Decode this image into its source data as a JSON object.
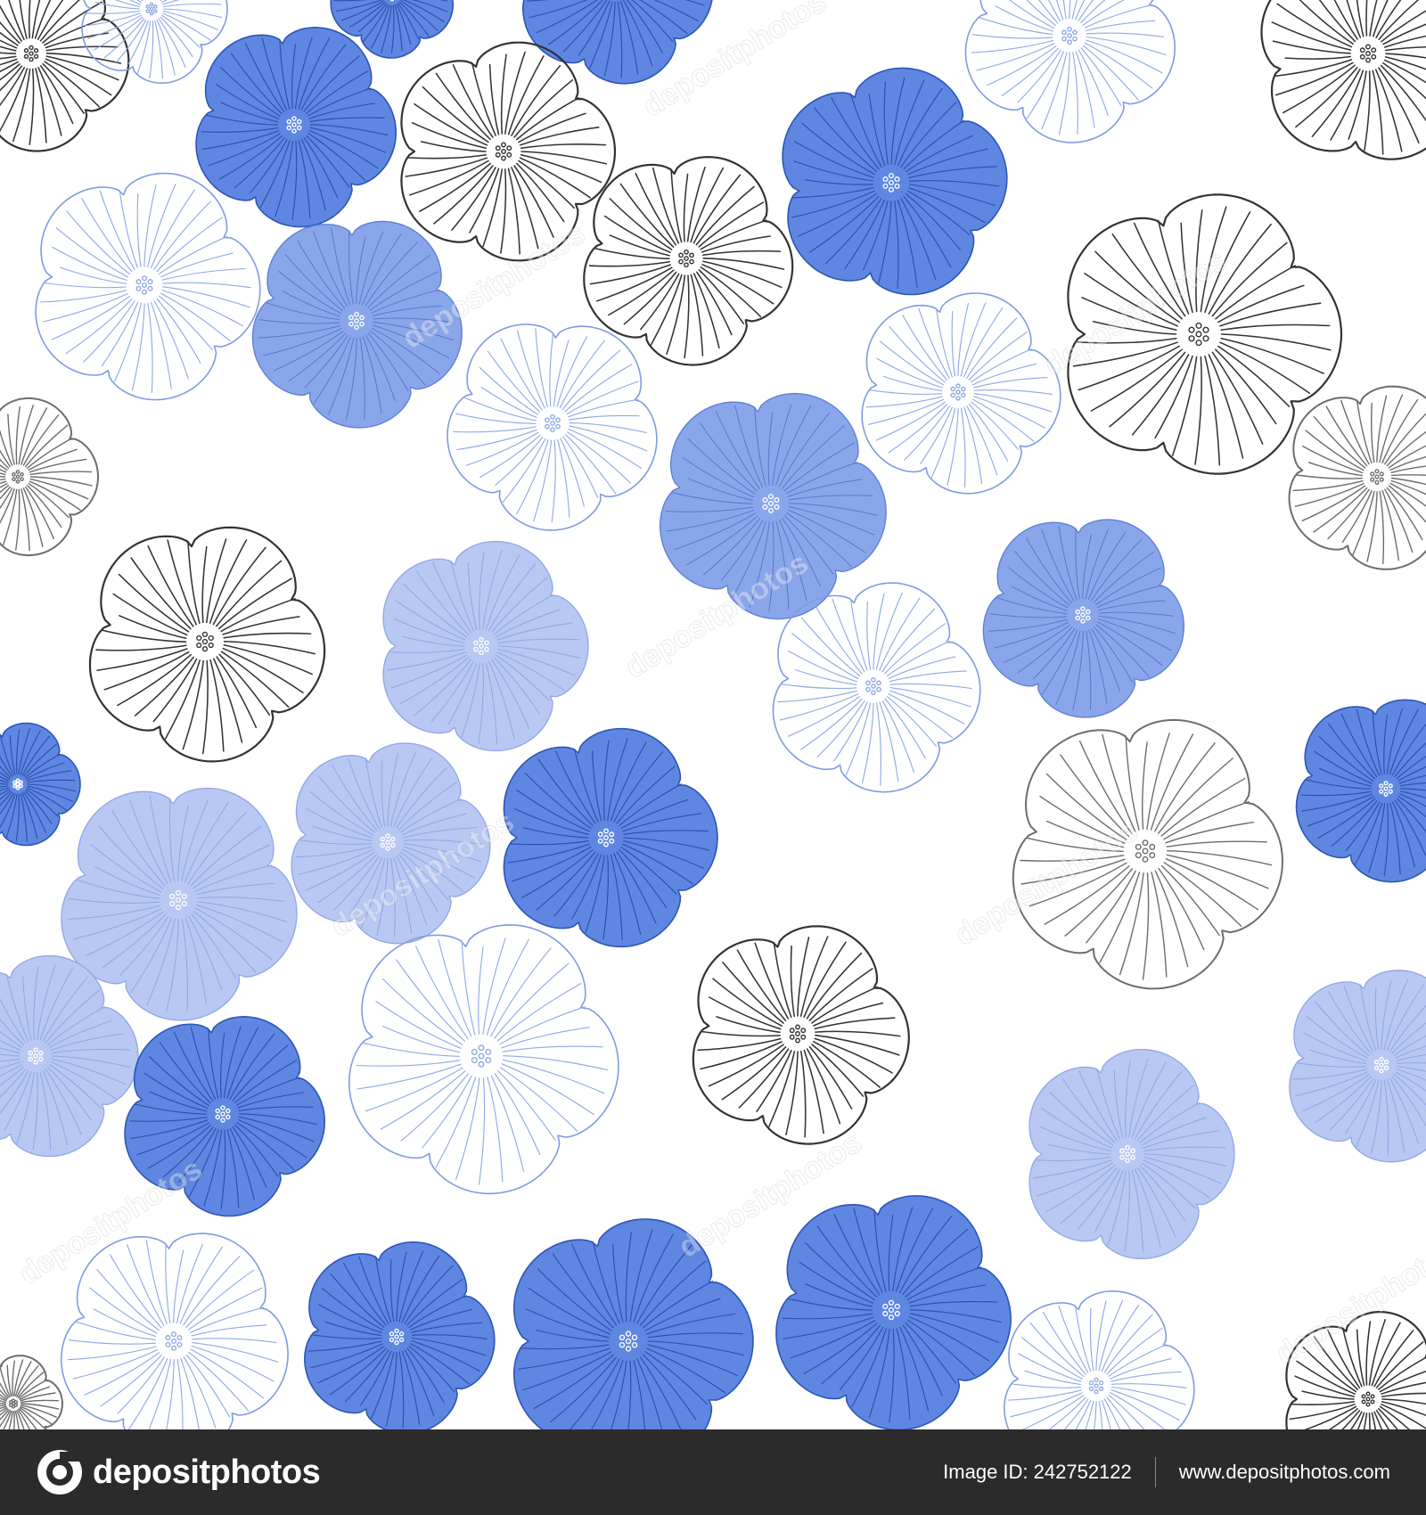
{
  "pattern": {
    "description_colors": {
      "background": "#ffffff",
      "dark_outline": "#3a3a3a",
      "blue_fill": "#5f86e0",
      "blue_light": "#aebfee",
      "blue_stroke": "#2d55b8",
      "light_stroke": "#7f9be2"
    },
    "watermark_text": "depositphotos"
  },
  "footer": {
    "logo_text": "depositphotos",
    "image_id": "Image ID: 242752122",
    "site": "www.depositphotos.com"
  }
}
